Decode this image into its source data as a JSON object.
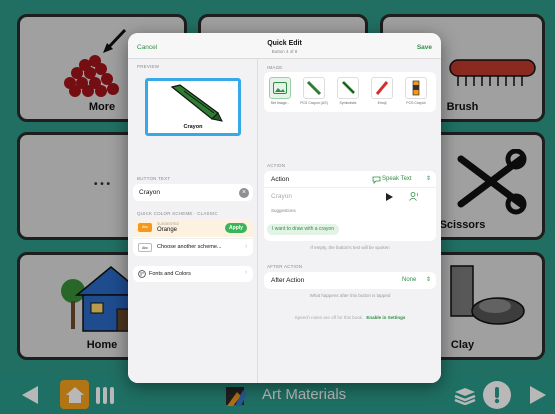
{
  "board": {
    "tiles": {
      "more": "More",
      "brush": "Brush",
      "scissors": "Scissors",
      "home": "Home",
      "clay": "Clay",
      "dots": "• • •"
    }
  },
  "toolbar": {
    "title": "Art Materials"
  },
  "modal": {
    "cancel": "Cancel",
    "save": "Save",
    "title": "Quick Edit",
    "subtitle": "Button 4 of 8",
    "preview": {
      "section": "PREVIEW",
      "label": "Crayon"
    },
    "button_text": {
      "section": "BUTTON TEXT",
      "value": "Crayon"
    },
    "color_scheme": {
      "section": "QUICK COLOR SCHEME · CLASSIC",
      "current_tag": "SUGGESTED",
      "current_name": "Orange",
      "swatch_text": "Abc",
      "apply": "Apply",
      "choose": "Choose another scheme..."
    },
    "fonts": "Fonts and Colors",
    "image": {
      "section": "IMAGE",
      "items": [
        "Set Image...",
        "PCS Crayon (US)",
        "Symbolstix",
        "Emoji",
        "PCS Crayon"
      ]
    },
    "action": {
      "section": "ACTION",
      "label": "Action",
      "value": "Speak Text",
      "placeholder": "Crayon",
      "suggestions_label": "Suggestions",
      "suggestion": "I want to draw with a crayon",
      "note": "If empty, the button's text will be spoken"
    },
    "after_action": {
      "section": "AFTER ACTION",
      "label": "After Action",
      "value": "None",
      "note": "What happens after this button is tapped"
    },
    "footer": {
      "note": "Speech notes are off for this book.",
      "link": "Enable in Settings"
    }
  },
  "colors": {
    "board": "#2f9a8a",
    "accent": "#2f8f45",
    "orange": "#f39a1e",
    "preview_border": "#37a9e6"
  }
}
